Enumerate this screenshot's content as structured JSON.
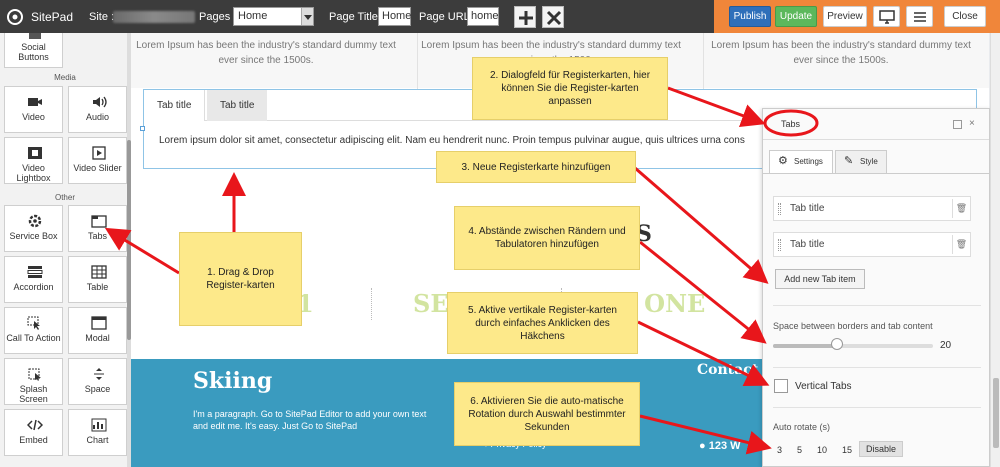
{
  "topbar": {
    "brand": "SitePad",
    "site_label": "Site :",
    "pages_label": "Pages :",
    "pages_value": "Home",
    "page_title_label": "Page Title:",
    "page_title_value": "Home",
    "page_url_label": "Page URL:",
    "page_url_value": "home",
    "publish": "Publish",
    "update": "Update",
    "preview": "Preview",
    "close": "Close",
    "accent_orange": "#f0863a"
  },
  "sidebar": {
    "sections": {
      "media": "Media",
      "other": "Other"
    },
    "widgets": {
      "social": "Social Buttons",
      "video": "Video",
      "audio": "Audio",
      "video_lightbox": "Video Lightbox",
      "video_slider": "Video Slider",
      "service_box": "Service Box",
      "tabs": "Tabs",
      "accordion": "Accordion",
      "table": "Table",
      "call_to_action": "Call To Action",
      "modal": "Modal",
      "splash_screen": "Splash Screen",
      "space": "Space",
      "embed": "Embed",
      "chart": "Chart"
    }
  },
  "canvas": {
    "hero_text": "Lorem Ipsum has been the industry's standard dummy text ever since the 1500s.",
    "tab1": "Tab title",
    "tab2": "Tab title",
    "tab_content": "Lorem ipsum dolor sit amet, consectetur adipiscing elit. Nam eu hendrerit nunc. Proin tempus pulvinar augue, quis ultrices urna cons",
    "big_s": "S",
    "big_one": "1",
    "big_sec": "SEC",
    "big_done": "D ONE",
    "skiing": "Skiing",
    "para": "I'm a paragraph. Go to SitePad Editor to add your own text and edit me. It's easy. Just Go to SitePad",
    "contact": "Contact",
    "privacy": "Privacy Policy",
    "address": "123 W",
    "blue_color": "#3a9bbf"
  },
  "panel": {
    "title": "Tabs",
    "tab_settings": "Settings",
    "tab_style": "Style",
    "items": [
      "Tab title",
      "Tab title"
    ],
    "add_button": "Add new Tab item",
    "space_label": "Space between borders and tab content",
    "space_value": "20",
    "vertical_label": "Vertical Tabs",
    "vertical_checked": false,
    "rotate_label": "Auto rotate (s)",
    "rotate_options": [
      "3",
      "5",
      "10",
      "15",
      "Disable"
    ],
    "rotate_selected": "Disable"
  },
  "annotations": {
    "n1": "1. Drag & Drop Register-karten",
    "n2": "2. Dialogfeld für Registerkarten, hier können Sie die Register-karten anpassen",
    "n3": "3. Neue Registerkarte hinzufügen",
    "n4": "4. Abstände zwischen Rändern und Tabulatoren hinzufügen",
    "n5": "5. Aktive vertikale Register-karten durch einfaches Anklicken des Häkchens",
    "n6": "6. Aktivieren Sie die auto-matische Rotation durch Auswahl bestimmter Sekunden",
    "note_color": "#fde98a",
    "arrow_color": "#e8161b"
  }
}
